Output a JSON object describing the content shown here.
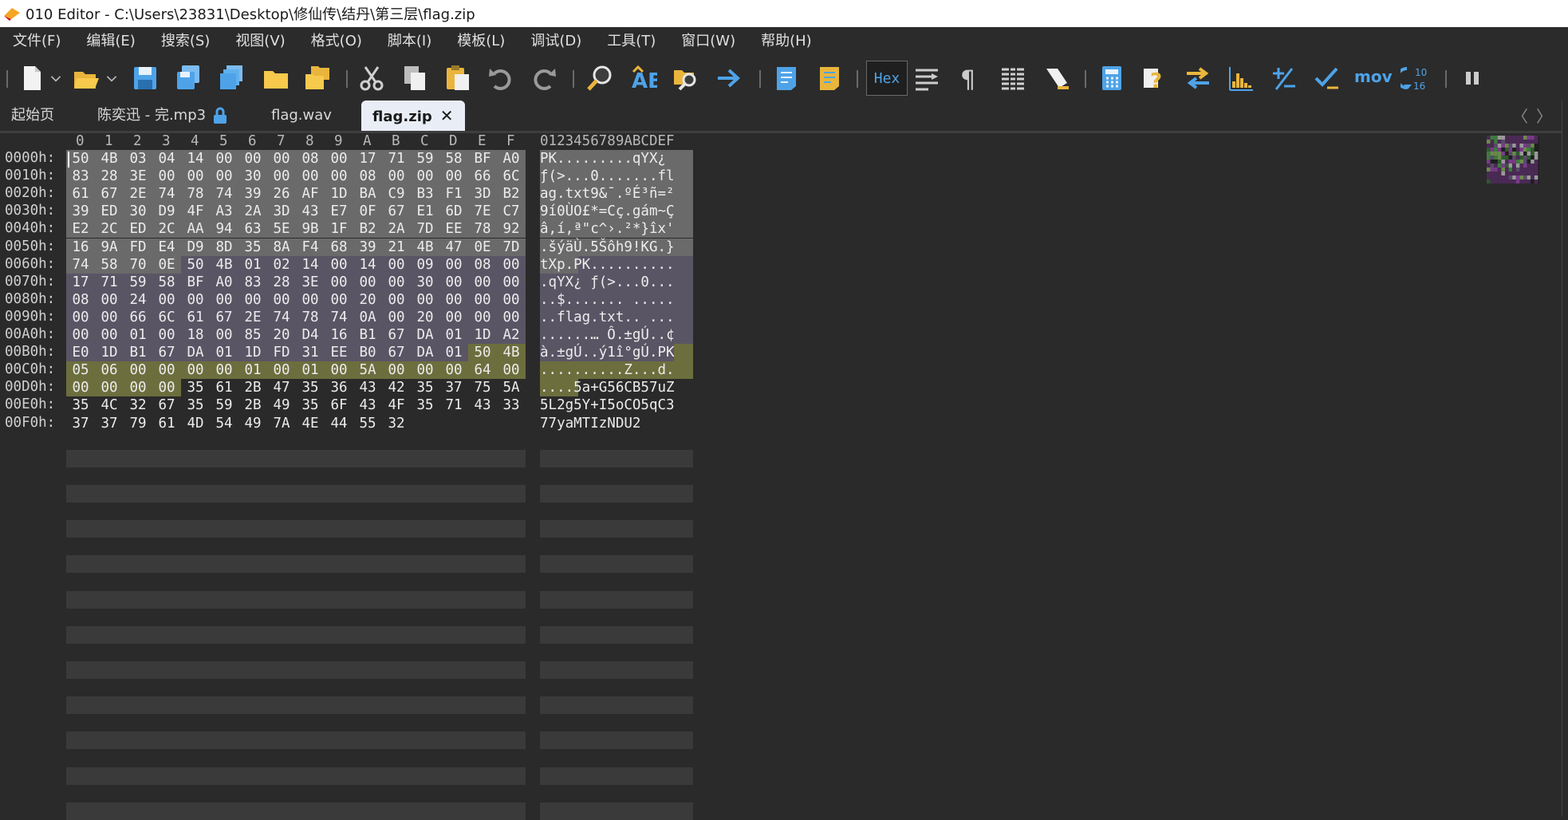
{
  "window": {
    "title": "010 Editor - C:\\Users\\23831\\Desktop\\修仙传\\结丹\\第三层\\flag.zip"
  },
  "menu": [
    {
      "label": "文件(F)",
      "name": "menu-file"
    },
    {
      "label": "编辑(E)",
      "name": "menu-edit"
    },
    {
      "label": "搜索(S)",
      "name": "menu-search"
    },
    {
      "label": "视图(V)",
      "name": "menu-view"
    },
    {
      "label": "格式(O)",
      "name": "menu-format"
    },
    {
      "label": "脚本(I)",
      "name": "menu-script"
    },
    {
      "label": "模板(L)",
      "name": "menu-template"
    },
    {
      "label": "调试(D)",
      "name": "menu-debug"
    },
    {
      "label": "工具(T)",
      "name": "menu-tools"
    },
    {
      "label": "窗口(W)",
      "name": "menu-window"
    },
    {
      "label": "帮助(H)",
      "name": "menu-help"
    }
  ],
  "toolbar": {
    "hex_label": "Hex",
    "mov_label": "mov",
    "convert_top": "10",
    "convert_bottom": "16"
  },
  "tabs": [
    {
      "label": "起始页",
      "active": false
    },
    {
      "label": "陈奕迅 - 完.mp3",
      "active": false
    },
    {
      "label": "flag.wav",
      "active": false
    },
    {
      "label": "flag.zip",
      "active": true
    }
  ],
  "hex": {
    "column_headers": [
      "0",
      "1",
      "2",
      "3",
      "4",
      "5",
      "6",
      "7",
      "8",
      "9",
      "A",
      "B",
      "C",
      "D",
      "E",
      "F"
    ],
    "ascii_header": "0123456789ABCDEF",
    "rows": [
      {
        "offset": "0000h:",
        "bytes": [
          "50",
          "4B",
          "03",
          "04",
          "14",
          "00",
          "00",
          "00",
          "08",
          "00",
          "17",
          "71",
          "59",
          "58",
          "BF",
          "A0"
        ],
        "ascii": "PK.........qYX¿ "
      },
      {
        "offset": "0010h:",
        "bytes": [
          "83",
          "28",
          "3E",
          "00",
          "00",
          "00",
          "30",
          "00",
          "00",
          "00",
          "08",
          "00",
          "00",
          "00",
          "66",
          "6C"
        ],
        "ascii": "ƒ(>...0.......fl"
      },
      {
        "offset": "0020h:",
        "bytes": [
          "61",
          "67",
          "2E",
          "74",
          "78",
          "74",
          "39",
          "26",
          "AF",
          "1D",
          "BA",
          "C9",
          "B3",
          "F1",
          "3D",
          "B2"
        ],
        "ascii": "ag.txt9&¯.ºÉ³ñ=²"
      },
      {
        "offset": "0030h:",
        "bytes": [
          "39",
          "ED",
          "30",
          "D9",
          "4F",
          "A3",
          "2A",
          "3D",
          "43",
          "E7",
          "0F",
          "67",
          "E1",
          "6D",
          "7E",
          "C7"
        ],
        "ascii": "9í0ÙO£*=Cç.gám~Ç"
      },
      {
        "offset": "0040h:",
        "bytes": [
          "E2",
          "2C",
          "ED",
          "2C",
          "AA",
          "94",
          "63",
          "5E",
          "9B",
          "1F",
          "B2",
          "2A",
          "7D",
          "EE",
          "78",
          "92"
        ],
        "ascii": "â,í,ª\"c^›.²*}îx'"
      },
      {
        "offset": "0050h:",
        "bytes": [
          "16",
          "9A",
          "FD",
          "E4",
          "D9",
          "8D",
          "35",
          "8A",
          "F4",
          "68",
          "39",
          "21",
          "4B",
          "47",
          "0E",
          "7D"
        ],
        "ascii": ".šýäÙ.5Šôh9!KG.}"
      },
      {
        "offset": "0060h:",
        "bytes": [
          "74",
          "58",
          "70",
          "0E",
          "50",
          "4B",
          "01",
          "02",
          "14",
          "00",
          "14",
          "00",
          "09",
          "00",
          "08",
          "00"
        ],
        "ascii": "tXp.PK.........."
      },
      {
        "offset": "0070h:",
        "bytes": [
          "17",
          "71",
          "59",
          "58",
          "BF",
          "A0",
          "83",
          "28",
          "3E",
          "00",
          "00",
          "00",
          "30",
          "00",
          "00",
          "00"
        ],
        "ascii": ".qYX¿ ƒ(>...0..."
      },
      {
        "offset": "0080h:",
        "bytes": [
          "08",
          "00",
          "24",
          "00",
          "00",
          "00",
          "00",
          "00",
          "00",
          "00",
          "20",
          "00",
          "00",
          "00",
          "00",
          "00"
        ],
        "ascii": "..$....... ....."
      },
      {
        "offset": "0090h:",
        "bytes": [
          "00",
          "00",
          "66",
          "6C",
          "61",
          "67",
          "2E",
          "74",
          "78",
          "74",
          "0A",
          "00",
          "20",
          "00",
          "00",
          "00"
        ],
        "ascii": "..flag.txt.. ..."
      },
      {
        "offset": "00A0h:",
        "bytes": [
          "00",
          "00",
          "01",
          "00",
          "18",
          "00",
          "85",
          "20",
          "D4",
          "16",
          "B1",
          "67",
          "DA",
          "01",
          "1D",
          "A2"
        ],
        "ascii": "......… Ô.±gÚ..¢"
      },
      {
        "offset": "00B0h:",
        "bytes": [
          "E0",
          "1D",
          "B1",
          "67",
          "DA",
          "01",
          "1D",
          "FD",
          "31",
          "EE",
          "B0",
          "67",
          "DA",
          "01",
          "50",
          "4B"
        ],
        "ascii": "à.±gÚ..ý1î°gÚ.PK"
      },
      {
        "offset": "00C0h:",
        "bytes": [
          "05",
          "06",
          "00",
          "00",
          "00",
          "00",
          "01",
          "00",
          "01",
          "00",
          "5A",
          "00",
          "00",
          "00",
          "64",
          "00"
        ],
        "ascii": "..........Z...d."
      },
      {
        "offset": "00D0h:",
        "bytes": [
          "00",
          "00",
          "00",
          "00",
          "35",
          "61",
          "2B",
          "47",
          "35",
          "36",
          "43",
          "42",
          "35",
          "37",
          "75",
          "5A"
        ],
        "ascii": "....5a+G56CB57uZ"
      },
      {
        "offset": "00E0h:",
        "bytes": [
          "35",
          "4C",
          "32",
          "67",
          "35",
          "59",
          "2B",
          "49",
          "35",
          "6F",
          "43",
          "4F",
          "35",
          "71",
          "43",
          "33"
        ],
        "ascii": "5L2g5Y+I5oCO5qC3"
      },
      {
        "offset": "00F0h:",
        "bytes": [
          "37",
          "37",
          "79",
          "61",
          "4D",
          "54",
          "49",
          "7A",
          "4E",
          "44",
          "55",
          "32"
        ],
        "ascii": "77yaMTIzNDU2"
      }
    ],
    "colors": {
      "local_header": "#6a6a6a",
      "central_dir": "#5a5565",
      "end_record": "#6c6e3d",
      "text": "#ececec"
    }
  }
}
